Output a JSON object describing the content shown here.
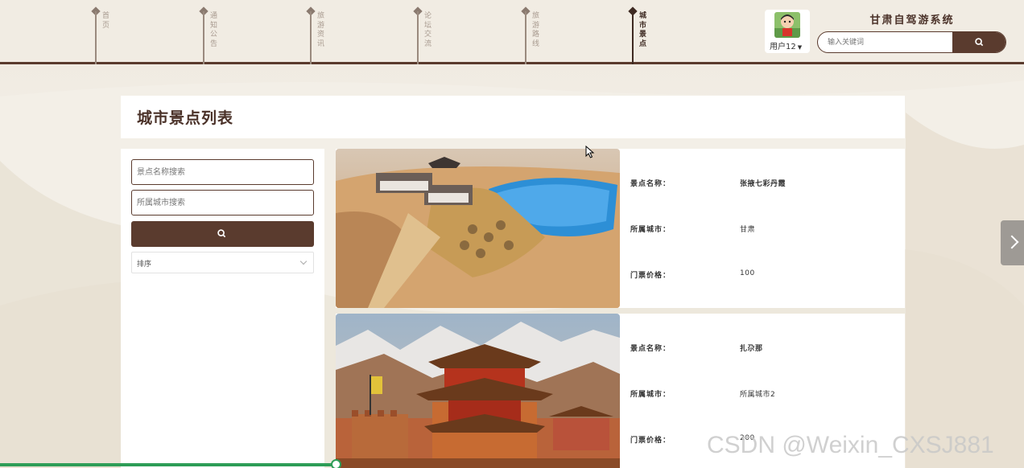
{
  "nav": {
    "items": [
      {
        "label": "首页",
        "active": false
      },
      {
        "label": "通知公告",
        "active": false
      },
      {
        "label": "旅游资讯",
        "active": false
      },
      {
        "label": "论坛交流",
        "active": false
      },
      {
        "label": "旅游路线",
        "active": false
      },
      {
        "label": "城市景点",
        "active": true
      }
    ]
  },
  "user": {
    "name": "用户12"
  },
  "site": {
    "title": "甘肃自驾游系统"
  },
  "header_search": {
    "placeholder": "输入关键词",
    "icon": "search-icon"
  },
  "page": {
    "title": "城市景点列表"
  },
  "filters": {
    "name_placeholder": "景点名称搜索",
    "city_placeholder": "所属城市搜索",
    "search_icon": "search-icon",
    "sort_label": "排序"
  },
  "spots": [
    {
      "name_label": "景点名称：",
      "name": "张掖七彩丹霞",
      "city_label": "所属城市：",
      "city": "甘肃",
      "price_label": "门票价格：",
      "price": "100",
      "image": "crescent-lake-dunes-image"
    },
    {
      "name_label": "景点名称：",
      "name": "扎尕那",
      "city_label": "所属城市：",
      "city": "所属城市2",
      "price_label": "门票价格：",
      "price": "200",
      "image": "jiayuguan-fort-image"
    }
  ],
  "watermark": "CSDN @Weixin_CXSJ881",
  "colors": {
    "brand": "#5a3b2e",
    "progress": "#2e9d57"
  }
}
